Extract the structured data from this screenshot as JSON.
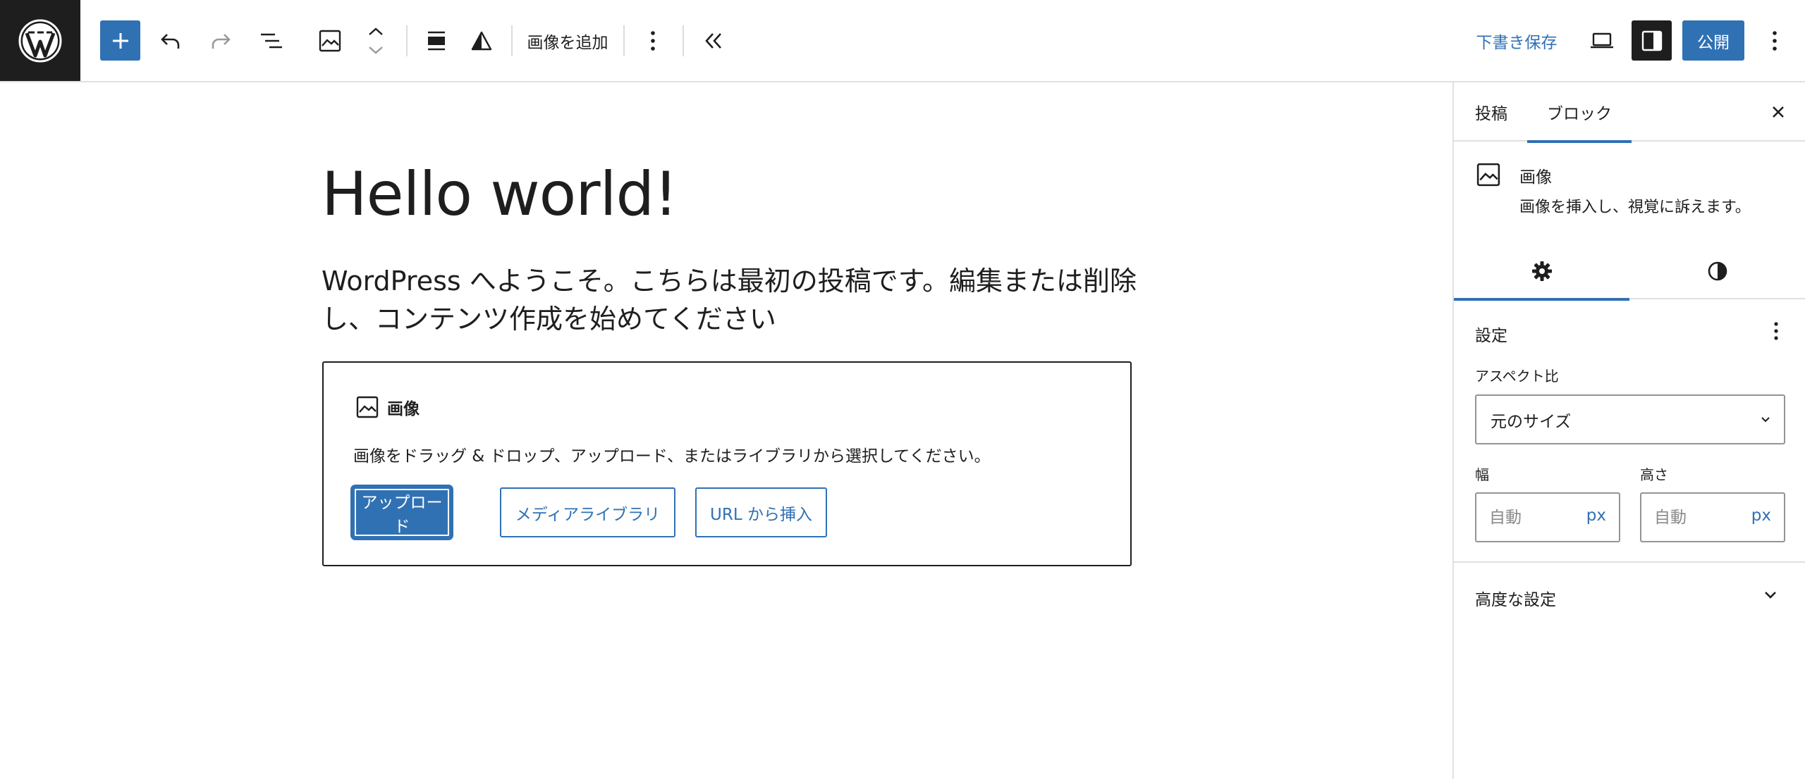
{
  "toolbar": {
    "image_add_label": "画像を追加",
    "save_draft_label": "下書き保存",
    "publish_label": "公開"
  },
  "post": {
    "title": "Hello world!",
    "paragraph": "WordPress へようこそ。こちらは最初の投稿です。編集または削除し、コンテンツ作成を始めてください"
  },
  "image_block": {
    "title": "画像",
    "description": "画像をドラッグ & ドロップ、アップロード、またはライブラリから選択してください。",
    "upload_label": "アップロード",
    "media_library_label": "メディアライブラリ",
    "insert_url_label": "URL から挿入"
  },
  "sidebar": {
    "tabs": [
      {
        "label": "投稿",
        "active": false
      },
      {
        "label": "ブロック",
        "active": true
      }
    ],
    "block_card": {
      "title": "画像",
      "description": "画像を挿入し、視覚に訴えます。"
    },
    "settings_panel": {
      "title": "設定",
      "aspect_ratio_label": "アスペクト比",
      "aspect_ratio_value": "元のサイズ",
      "width_label": "幅",
      "width_placeholder": "自動",
      "width_unit": "px",
      "height_label": "高さ",
      "height_placeholder": "自動",
      "height_unit": "px"
    },
    "advanced_label": "高度な設定"
  },
  "colors": {
    "accent": "#3071b4",
    "dark": "#1e1e1e",
    "border": "#e0e0e0"
  },
  "icons": [
    "wordpress-logo",
    "plus-icon",
    "undo-icon",
    "redo-icon",
    "list-view-icon",
    "image-icon",
    "chevron-up-icon",
    "chevron-down-icon",
    "align-icon",
    "triangle-icon",
    "more-vertical-icon",
    "collapse-icon",
    "desktop-preview-icon",
    "sidebar-toggle-icon",
    "close-icon",
    "gear-icon",
    "contrast-icon"
  ]
}
